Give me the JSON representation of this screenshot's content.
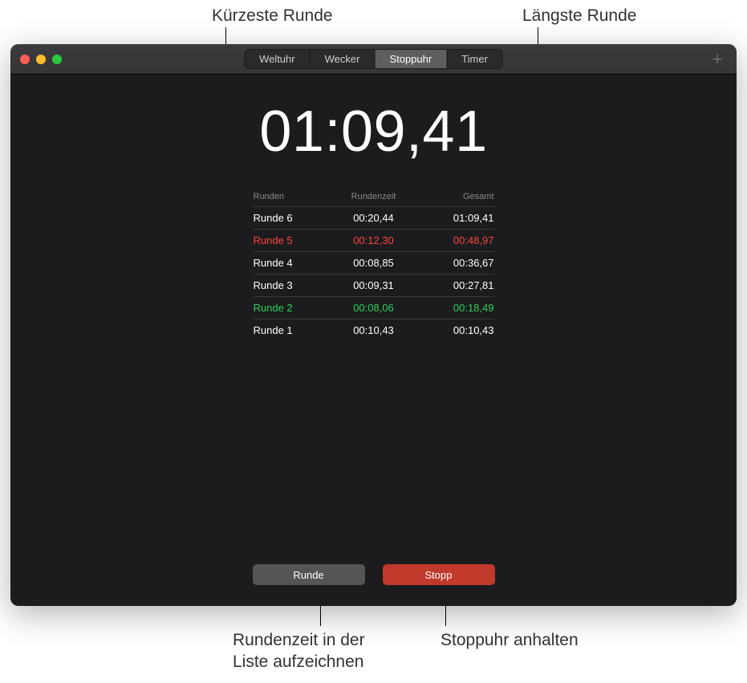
{
  "callouts": {
    "shortest": "Kürzeste Runde",
    "longest": "Längste Runde",
    "lap_record": "Rundenzeit in der\nListe aufzeichnen",
    "stop": "Stoppuhr anhalten"
  },
  "tabs": {
    "items": [
      "Weltuhr",
      "Wecker",
      "Stoppuhr",
      "Timer"
    ],
    "active_index": 2
  },
  "icons": {
    "add": "+"
  },
  "timer": {
    "display": "01:09,41"
  },
  "lap_table": {
    "headers": {
      "lap": "Runden",
      "time": "Rundenzeit",
      "total": "Gesamt"
    },
    "rows": [
      {
        "label": "Runde 6",
        "time": "00:20,44",
        "total": "01:09,41",
        "type": "normal"
      },
      {
        "label": "Runde 5",
        "time": "00:12,30",
        "total": "00:48,97",
        "type": "longest"
      },
      {
        "label": "Runde 4",
        "time": "00:08,85",
        "total": "00:36,67",
        "type": "normal"
      },
      {
        "label": "Runde 3",
        "time": "00:09,31",
        "total": "00:27,81",
        "type": "normal"
      },
      {
        "label": "Runde 2",
        "time": "00:08,06",
        "total": "00:18,49",
        "type": "shortest"
      },
      {
        "label": "Runde 1",
        "time": "00:10,43",
        "total": "00:10,43",
        "type": "normal"
      }
    ]
  },
  "buttons": {
    "lap": "Runde",
    "stop": "Stopp"
  }
}
